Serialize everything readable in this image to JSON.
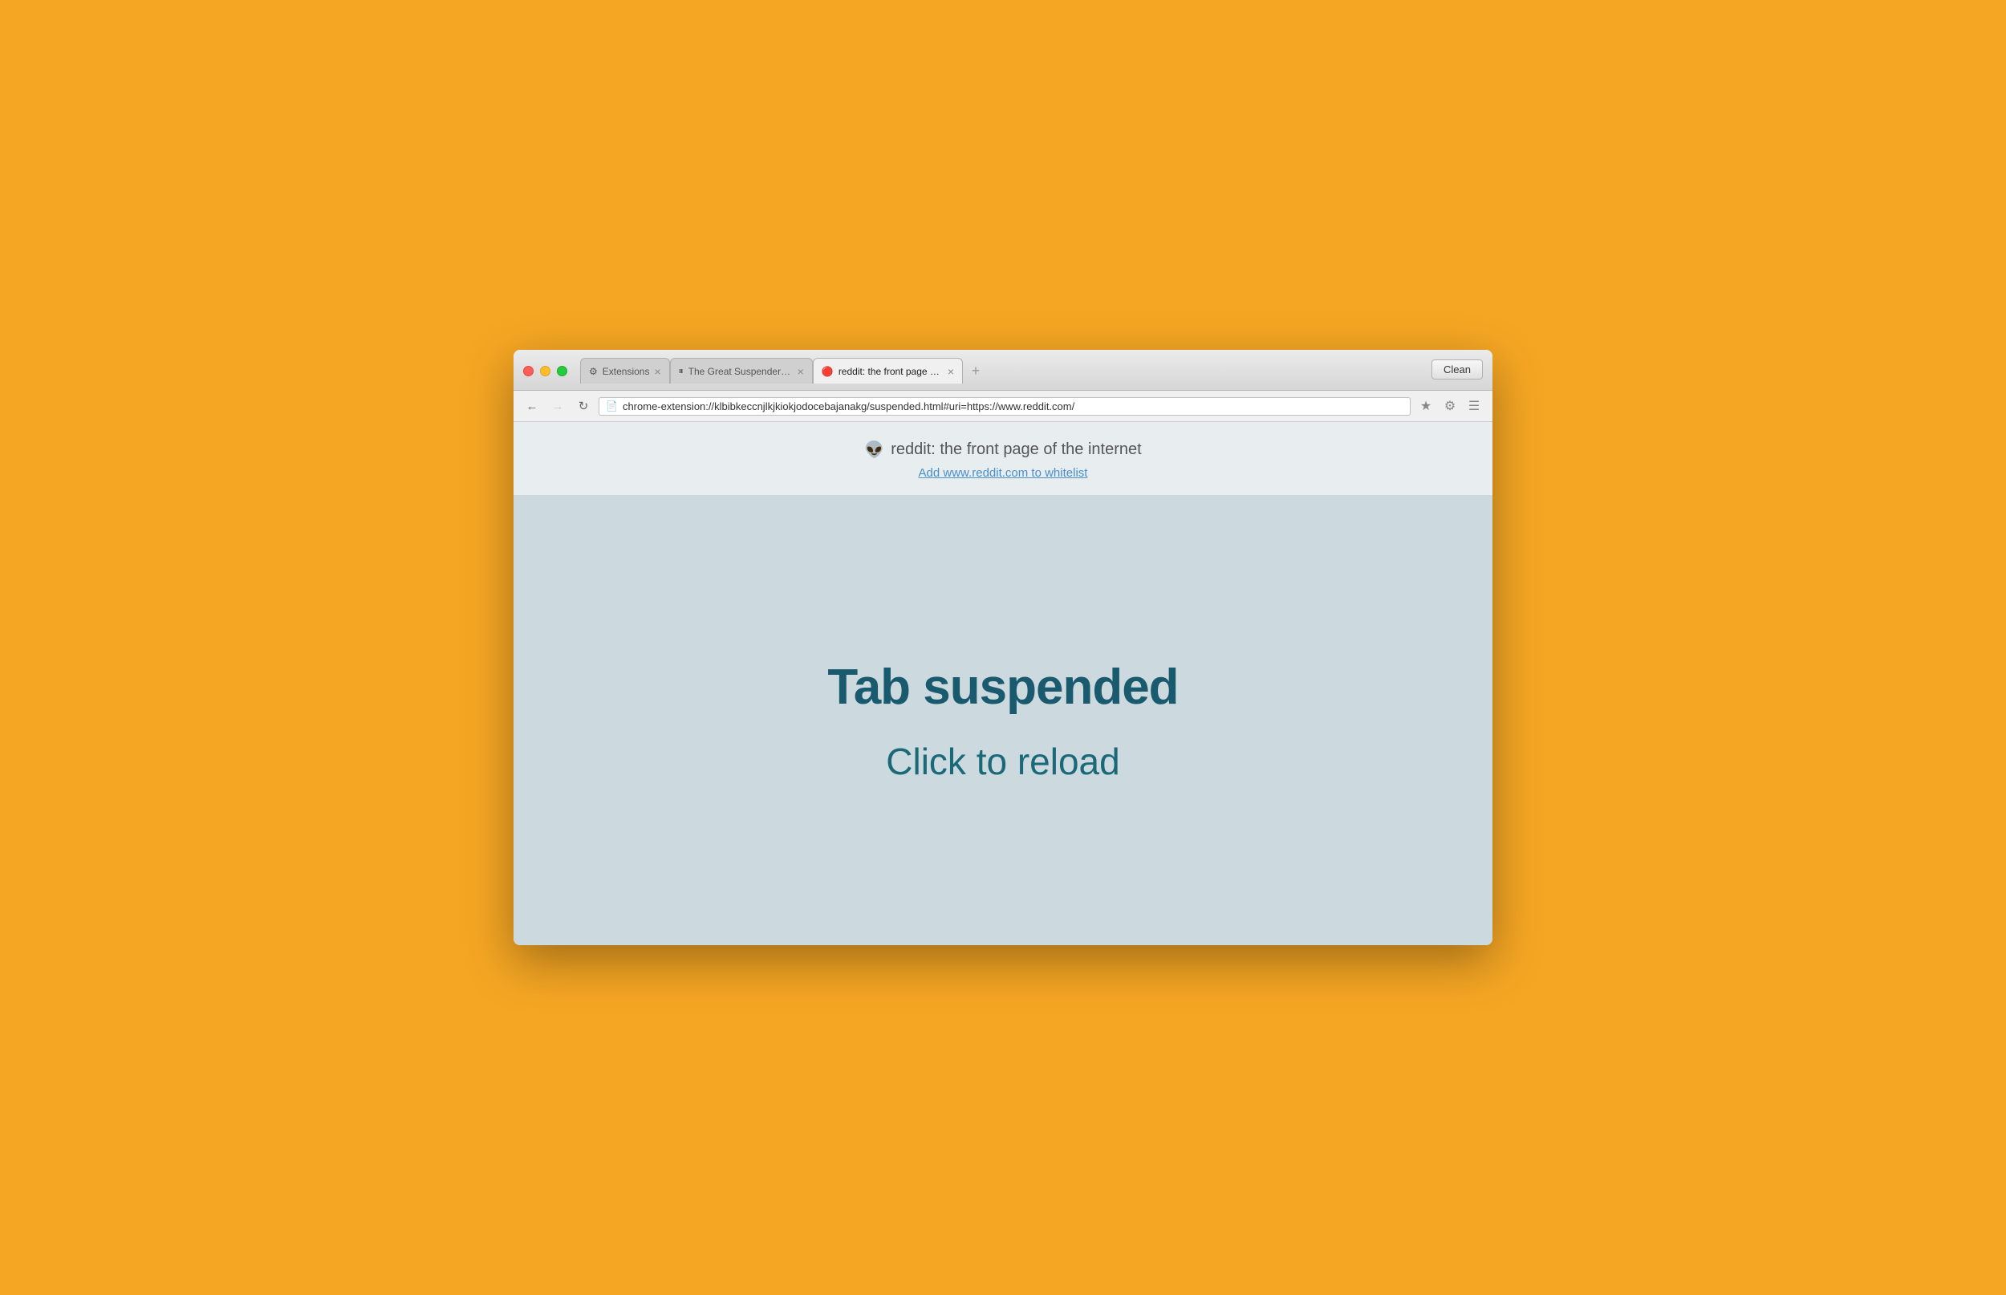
{
  "window": {
    "title": "reddit: the front page of the internet"
  },
  "tabs": [
    {
      "id": "tab-extensions",
      "label": "Extensions",
      "icon": "⚙",
      "active": false
    },
    {
      "id": "tab-great-suspender",
      "label": "The Great Suspender - Chi",
      "icon": "⏸",
      "active": false
    },
    {
      "id": "tab-reddit",
      "label": "reddit: the front page of th",
      "icon": "🔴",
      "active": true
    }
  ],
  "clean_button_label": "Clean",
  "address_bar": {
    "url": "chrome-extension://klbibkeccnjlkjkiokjodocebajanakg/suspended.html#uri=https://www.reddit.com/"
  },
  "page_header": {
    "site_icon": "👽",
    "title": "reddit: the front page of the internet",
    "whitelist_label": "Add www.reddit.com to whitelist"
  },
  "page_content": {
    "suspended_title": "Tab suspended",
    "reload_label": "Click to reload"
  },
  "nav": {
    "back_disabled": false,
    "forward_disabled": true
  }
}
